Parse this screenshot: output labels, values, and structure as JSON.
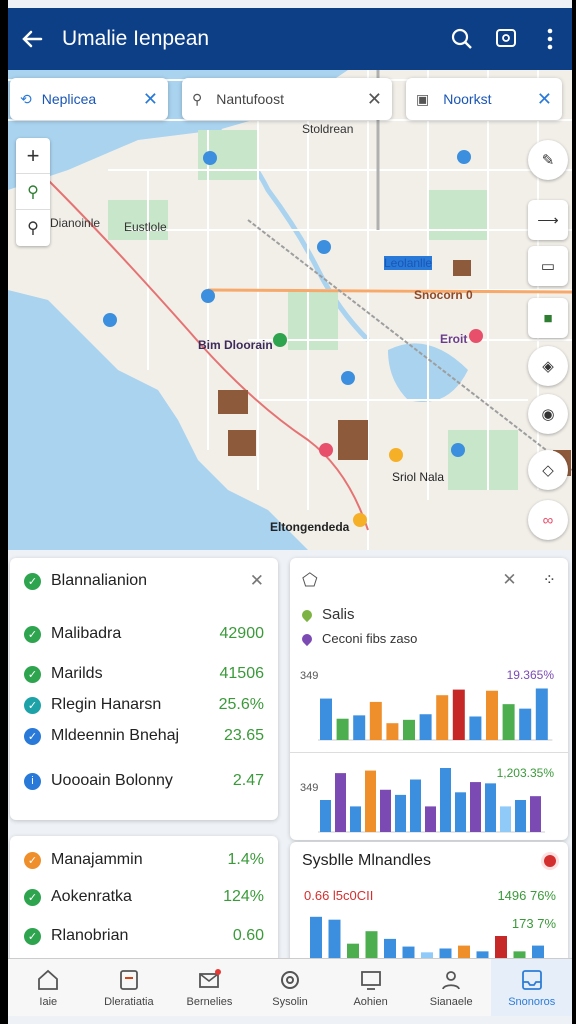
{
  "header": {
    "title": "Umalie Ienpean"
  },
  "search_chips": [
    {
      "label": "Neplicea"
    },
    {
      "label": "Nantufoost"
    },
    {
      "label": "Noorkst"
    }
  ],
  "map": {
    "labels": [
      "Stoldrean",
      "Eustlole",
      "Dianoinle",
      "Leolanlle",
      "Snocorn 0",
      "Bim Dloorain",
      "Eroit",
      "Sriol Nala",
      "Eltongendeda"
    ]
  },
  "list_card": {
    "title": "Blannalianion",
    "items": [
      {
        "label": "Malibadra",
        "value": "42900",
        "status": "green"
      },
      {
        "label": "Marilds",
        "value": "41506",
        "status": "green"
      },
      {
        "label": "Rlegin Hanarsn",
        "value": "25.6%",
        "status": "teal"
      },
      {
        "label": "Mldeennin Bnehaj",
        "value": "23.65",
        "status": "blue"
      },
      {
        "label": "Uoooain Bolonny",
        "value": "2.47",
        "status": "blue"
      }
    ]
  },
  "list_card2": {
    "items": [
      {
        "label": "Manajammin",
        "value": "1.4%",
        "status": "orange"
      },
      {
        "label": "Aokenratka",
        "value": "124%",
        "status": "green"
      },
      {
        "label": "Rlanobrian",
        "value": "0.60",
        "status": "green"
      }
    ]
  },
  "chart_card": {
    "legend": [
      {
        "label": "Salis",
        "color": "#7cb342"
      },
      {
        "label": "Ceconi fibs zaso",
        "color": "#7b4bb3"
      }
    ]
  },
  "sub_card": {
    "title": "Sysblle Mlnandles",
    "note1": "0.66 l5c0CII",
    "note2": "1496 76%",
    "note3": "173 7%"
  },
  "chart_data": [
    {
      "type": "bar",
      "title": "",
      "annotation": "19.365%",
      "ytick": "349",
      "values": [
        74,
        38,
        44,
        68,
        30,
        36,
        46,
        80,
        90,
        42,
        88,
        64,
        56,
        92
      ],
      "colors": [
        "#3b8fde",
        "#4cae4f",
        "#3b8fde",
        "#ef8f2c",
        "#ef8f2c",
        "#4cae4f",
        "#3b8fde",
        "#ef8f2c",
        "#c62828",
        "#3b8fde",
        "#ef8f2c",
        "#4cae4f",
        "#3b8fde",
        "#3b8fde"
      ]
    },
    {
      "type": "bar",
      "title": "",
      "annotation": "1,203.35%",
      "ytick": "349",
      "values": [
        50,
        92,
        40,
        96,
        66,
        58,
        82,
        40,
        100,
        62,
        78,
        76,
        40,
        50,
        56
      ],
      "colors": [
        "#3b8fde",
        "#7b4bb3",
        "#3b8fde",
        "#ef8f2c",
        "#7b4bb3",
        "#3b8fde",
        "#3b8fde",
        "#7b4bb3",
        "#3b8fde",
        "#3b8fde",
        "#7b4bb3",
        "#3b8fde",
        "#90caf9",
        "#3b8fde",
        "#7b4bb3"
      ]
    },
    {
      "type": "bar",
      "title": "",
      "values": [
        90,
        84,
        34,
        60,
        44,
        28,
        16,
        24,
        30,
        18,
        50,
        18,
        30
      ],
      "colors": [
        "#3b8fde",
        "#3b8fde",
        "#4cae4f",
        "#4cae4f",
        "#3b8fde",
        "#3b8fde",
        "#90caf9",
        "#3b8fde",
        "#ef8f2c",
        "#3b8fde",
        "#c62828",
        "#4cae4f",
        "#3b8fde"
      ]
    }
  ],
  "bottom_nav": [
    {
      "label": "Iaie",
      "icon": "home-icon"
    },
    {
      "label": "Dleratiatia",
      "icon": "document-icon"
    },
    {
      "label": "Bernelies",
      "icon": "mail-icon"
    },
    {
      "label": "Sysolin",
      "icon": "settings-icon"
    },
    {
      "label": "Aohien",
      "icon": "monitor-icon"
    },
    {
      "label": "Sianaele",
      "icon": "person-icon"
    },
    {
      "label": "Snonoros",
      "icon": "inbox-icon"
    }
  ]
}
